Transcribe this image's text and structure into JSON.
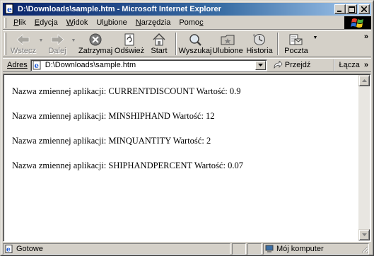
{
  "window": {
    "title": "D:\\Downloads\\sample.htm - Microsoft Internet Explorer"
  },
  "title_buttons": {
    "minimize": "_",
    "maximize": "□",
    "close": "×"
  },
  "menu": {
    "items": [
      {
        "pre": "",
        "u": "P",
        "post": "lik"
      },
      {
        "pre": "",
        "u": "E",
        "post": "dycja"
      },
      {
        "pre": "",
        "u": "W",
        "post": "idok"
      },
      {
        "pre": "Ul",
        "u": "u",
        "post": "bione"
      },
      {
        "pre": "",
        "u": "N",
        "post": "arzędzia"
      },
      {
        "pre": "Pomo",
        "u": "c",
        "post": ""
      }
    ]
  },
  "toolbar": {
    "back": "Wstecz",
    "forward": "Dalej",
    "stop": "Zatrzymaj",
    "refresh": "Odśwież",
    "home": "Start",
    "search": "Wyszukaj",
    "favorites": "Ulubione",
    "history": "Historia",
    "mail": "Poczta",
    "more": "»"
  },
  "address": {
    "label": "Adres",
    "url": "D:\\Downloads\\sample.htm",
    "go_label": "Przejdź",
    "links_label": "Łącza",
    "links_more": "»"
  },
  "content": {
    "lines": [
      "Nazwa zmiennej aplikacji: CURRENTDISCOUNT Wartość: 0.9",
      "Nazwa zmiennej aplikacji: MINSHIPHAND Wartość: 12",
      "Nazwa zmiennej aplikacji: MINQUANTITY Wartość: 2",
      "Nazwa zmiennej aplikacji: SHIPHANDPERCENT Wartość: 0.07"
    ]
  },
  "status": {
    "text": "Gotowe",
    "zone": "Mój komputer"
  },
  "colors": {
    "titlebar_start": "#0a246a",
    "titlebar_end": "#a6caf0",
    "chrome": "#d4d0c8"
  }
}
